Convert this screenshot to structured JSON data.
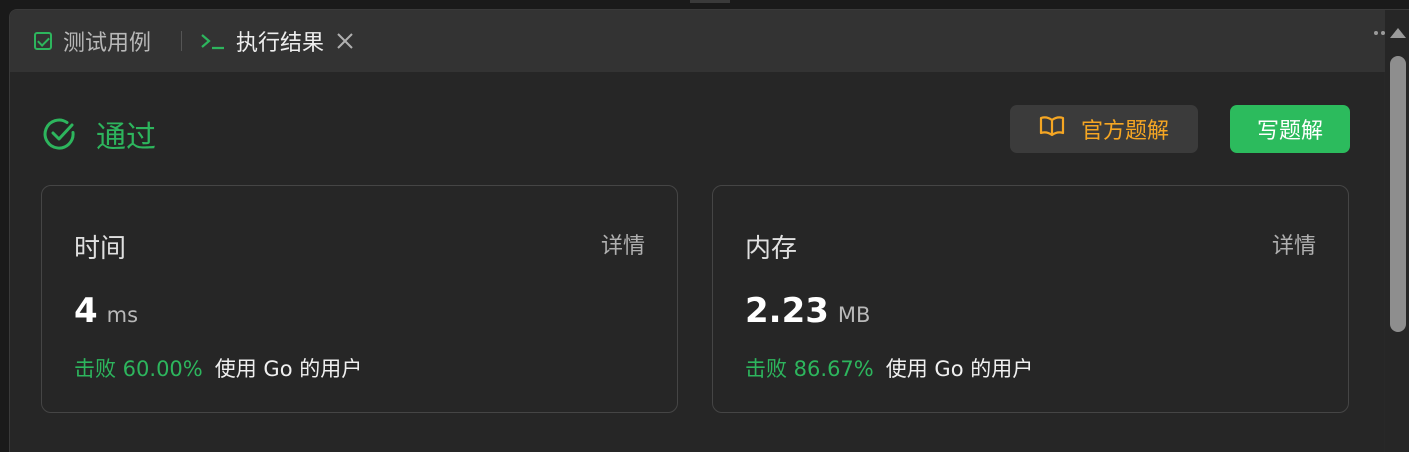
{
  "tabs": {
    "testcase": {
      "label": "测试用例",
      "icon": "checkbox-icon"
    },
    "result": {
      "label": "执行结果",
      "icon": "terminal-icon"
    }
  },
  "status": {
    "label": "通过",
    "icon": "check-circle-icon",
    "color": "#2db55d"
  },
  "buttons": {
    "official": {
      "label": "官方题解",
      "icon": "book-icon",
      "color": "#f5a623"
    },
    "write": {
      "label": "写题解",
      "color": "#2cbb5d"
    }
  },
  "cards": {
    "time": {
      "title": "时间",
      "detail": "详情",
      "value": "4",
      "unit": "ms",
      "beat": "击败 60.00%",
      "beat_rest": "使用 Go 的用户"
    },
    "memory": {
      "title": "内存",
      "detail": "详情",
      "value": "2.23",
      "unit": "MB",
      "beat": "击败 86.67%",
      "beat_rest": "使用 Go 的用户"
    }
  }
}
